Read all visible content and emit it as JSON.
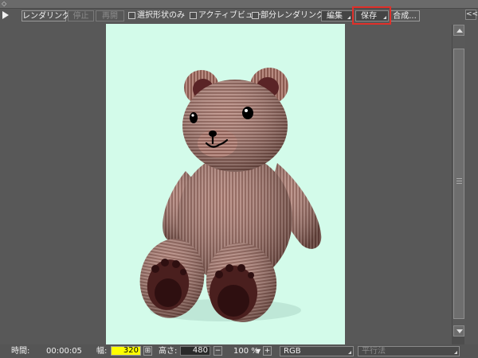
{
  "toolbar": {
    "render_button": "レンダリング",
    "stop_button": "停止",
    "resume_button": "再開",
    "selected_shapes_only": "選択形状のみ",
    "active_view": "アクティブビュー",
    "partial_rendering": "部分レンダリング",
    "edit_menu": "編集",
    "save_menu": "保存",
    "compose_button": "合成..."
  },
  "panel": {
    "collapse_label": "<<"
  },
  "canvas": {
    "background": "#d3fbea",
    "subject": "teddy bear"
  },
  "status": {
    "time_label": "時間:",
    "time_value": "00:00:05",
    "width_label": "幅:",
    "width_value": "320",
    "height_label": "高さ:",
    "height_value": "480",
    "zoom_value": "100 %",
    "color_mode": "RGB",
    "projection": "平行法"
  },
  "colors": {
    "highlight": "#e0302a",
    "width_field": "#ffff00"
  }
}
